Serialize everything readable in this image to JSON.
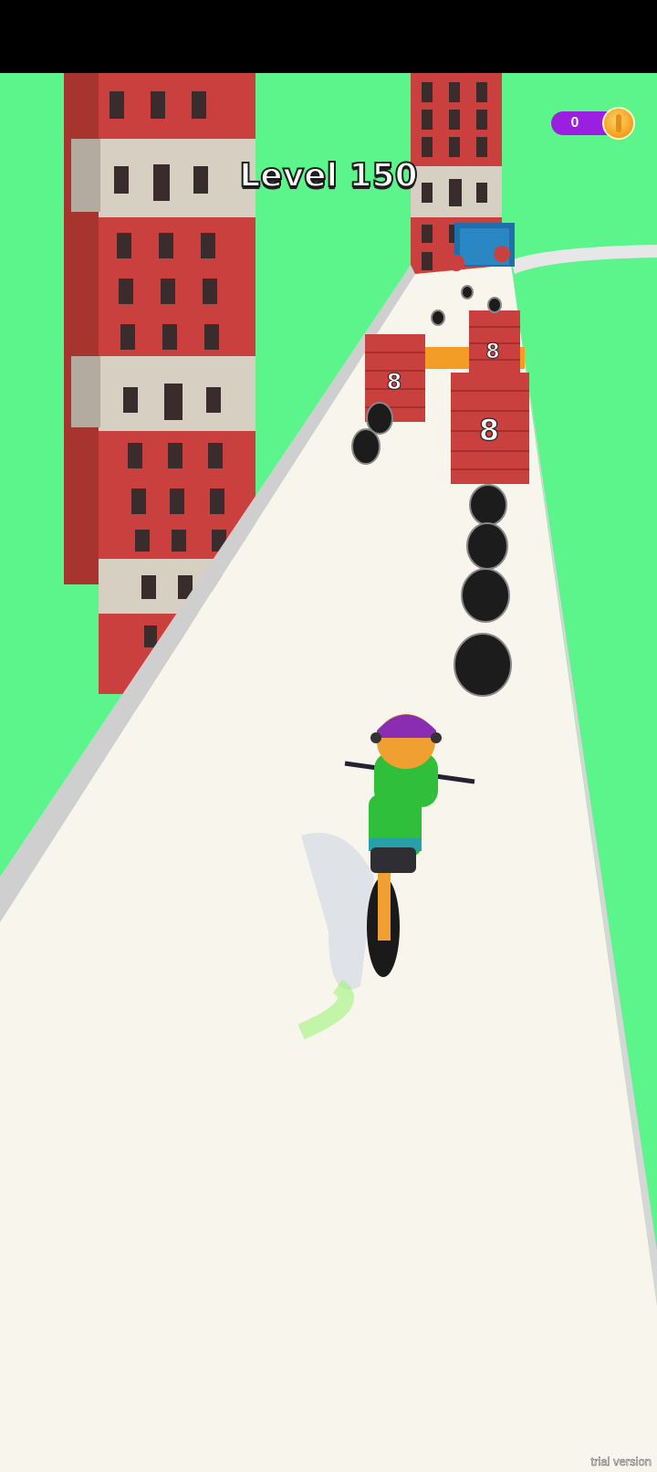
{
  "hud": {
    "level_label": "Level 150",
    "coin_count": "0",
    "coin_icon": "coin-icon"
  },
  "obstacles": {
    "brick_wall_left_count": "8",
    "brick_wall_far_count": "8",
    "brick_wall_near_count": "8"
  },
  "watermark": "trial version",
  "colors": {
    "sky_green": "#5cf58c",
    "road": "#f8f6ec",
    "brick": "#c9403e",
    "coin_pill": "#9b1fe0",
    "rider_shirt": "#2fbf3a",
    "rider_helmet": "#8a2db3"
  }
}
